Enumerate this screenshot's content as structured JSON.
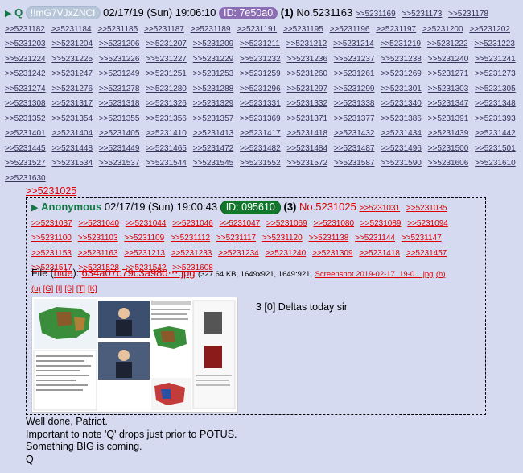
{
  "header": {
    "q_label": "Q",
    "tripcode": "!!mG7VJxZNCI",
    "date": "02/17/19 (Sun) 19:06:10",
    "id_label": "ID: 7e50a0",
    "count": "(1)",
    "post_no": "No.5231163",
    "backlinks": [
      ">>5231169",
      ">>5231173",
      ">>5231178",
      ">>5231182",
      ">>5231184",
      ">>5231185",
      ">>5231187",
      ">>5231189",
      ">>5231191",
      ">>5231195",
      ">>5231196",
      ">>5231197",
      ">>5231200",
      ">>5231202",
      ">>5231203",
      ">>5231204",
      ">>5231206",
      ">>5231207",
      ">>5231209",
      ">>5231211",
      ">>5231212",
      ">>5231214",
      ">>5231219",
      ">>5231222",
      ">>5231223",
      ">>5231224",
      ">>5231225",
      ">>5231226",
      ">>5231227",
      ">>5231229",
      ">>5231232",
      ">>5231236",
      ">>5231237",
      ">>5231238",
      ">>5231240",
      ">>5231241",
      ">>5231242",
      ">>5231247",
      ">>5231249",
      ">>5231251",
      ">>5231253",
      ">>5231259",
      ">>5231260",
      ">>5231261",
      ">>5231269",
      ">>5231271",
      ">>5231273",
      ">>5231274",
      ">>5231276",
      ">>5231278",
      ">>5231280",
      ">>5231288",
      ">>5231296",
      ">>5231297",
      ">>5231299",
      ">>5231301",
      ">>5231303",
      ">>5231305",
      ">>5231308",
      ">>5231317",
      ">>5231318",
      ">>5231326",
      ">>5231329",
      ">>5231331",
      ">>5231332",
      ">>5231338",
      ">>5231340",
      ">>5231347",
      ">>5231348",
      ">>5231352",
      ">>5231354",
      ">>5231355",
      ">>5231356",
      ">>5231357",
      ">>5231369",
      ">>5231371",
      ">>5231377",
      ">>5231386",
      ">>5231391",
      ">>5231393",
      ">>5231401",
      ">>5231404",
      ">>5231405",
      ">>5231410",
      ">>5231413",
      ">>5231417",
      ">>5231418",
      ">>5231432",
      ">>5231434",
      ">>5231439",
      ">>5231442",
      ">>5231445",
      ">>5231448",
      ">>5231449",
      ">>5231465",
      ">>5231472",
      ">>5231482",
      ">>5231484",
      ">>5231487",
      ">>5231496",
      ">>5231500",
      ">>5231501",
      ">>5231527",
      ">>5231534",
      ">>5231537",
      ">>5231544",
      ">>5231545",
      ">>5231552",
      ">>5231572",
      ">>5231587",
      ">>5231590",
      ">>5231606",
      ">>5231610",
      ">>5231630"
    ]
  },
  "quoted": {
    "link": ">>5231025",
    "name": "Anonymous",
    "date": "02/17/19 (Sun) 19:00:43",
    "id_label": "ID: 095610",
    "count": "(3)",
    "post_no": "No.5231025",
    "backlinks": [
      ">>5231031",
      ">>5231035",
      ">>5231037",
      ">>5231040",
      ">>5231044",
      ">>5231046",
      ">>5231047",
      ">>5231069",
      ">>5231080",
      ">>5231089",
      ">>5231094",
      ">>5231100",
      ">>5231103",
      ">>5231109",
      ">>5231112",
      ">>5231117",
      ">>5231120",
      ">>5231138",
      ">>5231144",
      ">>5231147",
      ">>5231153",
      ">>5231163",
      ">>5231213",
      ">>5231233",
      ">>5231234",
      ">>5231240",
      ">>5231309",
      ">>5231418",
      ">>5231457",
      ">>5231517",
      ">>5231528",
      ">>5231542",
      ">>5231608"
    ],
    "file_label": "File",
    "hide": "hide",
    "filename": "634a07c79c3a980⋯.jpg",
    "file_meta": "(327.64 KB, 1649x921, 1649:921,",
    "file_orig": "Screenshot 2019-02-17_19-0....jpg",
    "file_h": "(h)",
    "tools": [
      "(u)",
      "[G]",
      "[I]",
      "[S]",
      "[T]",
      "[K]"
    ],
    "message": "3 [0] Deltas today sir"
  },
  "message_lines": [
    "Well done, Patriot.",
    "Important to note 'Q' drops just prior to POTUS.",
    "Something BIG is coming.",
    "Q"
  ],
  "colors": {
    "background": "#d6daf0",
    "name_green": "#117743",
    "link_blue": "#34345c",
    "quote_red": "#dd0000",
    "id_purple": "#8b6db3",
    "id_green": "#11772b"
  }
}
